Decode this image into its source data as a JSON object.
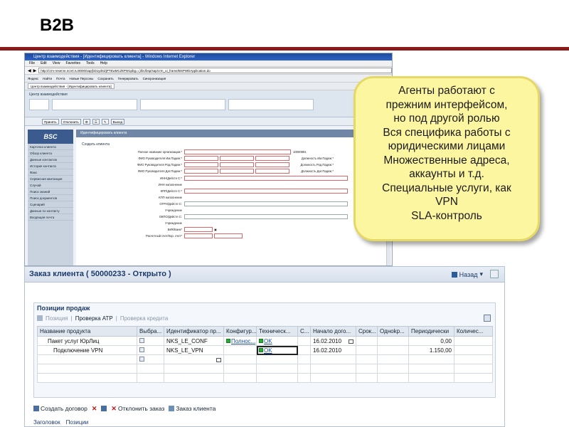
{
  "slide": {
    "title": "B2B"
  },
  "browser": {
    "window_title": "Центр взаимодействия - [Идентифицировать клиента] - Windows Internet Explorer",
    "menu": [
      "File",
      "Edit",
      "View",
      "Favorites",
      "Tools",
      "Help"
    ],
    "address": "http://crm-reserve.ncrel.ru:8000/sap(bD1ydSZjPTEwMCZkPW1pbg==)/bc/bsp/sap/crm_ui_frame/BSPWDApplication.do",
    "toolbar_items": [
      "Яндекс",
      "Найти",
      "Почта",
      "Новые Персоны",
      "Сохранить",
      "Генерировать",
      "Синхронизация"
    ],
    "tab_label": "Центр взаимодействия - [Идентифицировать клиента]",
    "crm_title": "Центр взаимодействия",
    "crm_actions": [
      "Принять",
      "Отклонить",
      "Выход"
    ],
    "logo": "BSC",
    "nav_items": [
      "Карточка клиента",
      "Обзор клиента",
      "Данные контактов",
      "История контакта",
      "Факс",
      "Сервисная квитанция",
      "Случай",
      "Поиск знаний",
      "Поиск документов",
      "Сценарий",
      "Данные по контакту",
      "Входящая почта"
    ],
    "main_header": "Идентифицировать клиента",
    "section_title": "Создать клиента",
    "form_rows": [
      {
        "label": "Полное название организации:*",
        "value": "10000891"
      },
      {
        "label": "ФИО Руководителя Им.Падеж:*",
        "right_label": "Должность Им.Падеж:*"
      },
      {
        "label": "ФИО Руководителя Род.Падеж:*",
        "right_label": "Должность Род.Падеж:*"
      },
      {
        "label": "ФИО Руководителя Дат.Падеж:*",
        "right_label": "Должность Дат.Падеж:*"
      },
      {
        "label": "ИНН/Дейсте С:*"
      },
      {
        "label": "ИНН наполнение"
      },
      {
        "label": "КПП/Дейсте С:*"
      },
      {
        "label": "КПП наполнение"
      },
      {
        "label": "ОГРН/Дейсте С:"
      },
      {
        "label": "Учреждение"
      },
      {
        "label": "ОКПО/Дейсте С:"
      },
      {
        "label": "Учреждение"
      },
      {
        "label": "БИК/Банк*"
      },
      {
        "label": "Расчетный счет/Кор. счет*"
      }
    ]
  },
  "callout": {
    "lines": [
      "Агенты работают с",
      "прежним интерфейсом,",
      "но под другой ролью",
      "Вся специфика работы с",
      "юридическими лицами",
      "Множественные адреса,",
      "аккаунты и т.д.",
      "Специальные услуги, как",
      "VPN",
      "SLA-контроль"
    ]
  },
  "order": {
    "title": "Заказ клиента ( 50000233 - Открыто )",
    "back_label": "Назад",
    "panel_title": "Позиции продаж",
    "tabs": {
      "position": "Позиция",
      "atp": "Проверка ATP",
      "credit": "Проверка кредита"
    },
    "columns": [
      "Название продукта",
      "Выбра...",
      "Идентификатор пр...",
      "Конфигур...",
      "Техническ...",
      "С...",
      "Начало дого...",
      "Срок...",
      "Одноkр...",
      "Периодически",
      "Количес..."
    ],
    "rows": [
      {
        "name": "Пакет услуг ЮрЛиц",
        "product_id": "NKS_LE_CONF",
        "config": "Полнос...",
        "tech": "OK",
        "start": "16.02.2010",
        "periodic": "0,00"
      },
      {
        "name": "Подключение VPN",
        "product_id": "NKS_LE_VPN",
        "config": "",
        "tech": "OK",
        "start": "16.02.2010",
        "periodic": "1.150,00"
      },
      {
        "name": "",
        "product_id": "",
        "config": "",
        "tech": "",
        "start": "",
        "periodic": ""
      }
    ],
    "footer": {
      "create_contract": "Создать договор",
      "reject_order": "Отклонить заказ",
      "client_order": "Заказ клиента"
    },
    "bottom_tabs": [
      "Заголовок",
      "Позиции"
    ]
  },
  "colors": {
    "title_rule": "#8b1a1a",
    "callout_fill": "#fdf6a0",
    "status_ok": "#2eaa3a"
  }
}
